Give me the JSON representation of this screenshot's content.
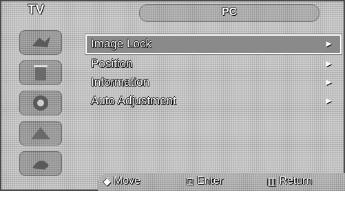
{
  "header": {
    "title": "TV",
    "menu_title": "PC"
  },
  "sidebar": {
    "icons": [
      "picture-icon",
      "sound-icon",
      "channel-icon",
      "setup-icon",
      "input-icon"
    ]
  },
  "menu": {
    "items": [
      {
        "label": "Image Lock",
        "arrow": "►",
        "selected": true
      },
      {
        "label": "Position",
        "arrow": "►"
      },
      {
        "label": "Information",
        "arrow": "►"
      },
      {
        "label": "Auto Adjustment",
        "arrow": "►"
      }
    ]
  },
  "footer": {
    "move": {
      "icon": "◆",
      "label": "Move"
    },
    "enter": {
      "icon": "⊡",
      "label": "Enter"
    },
    "return": {
      "icon": "▥",
      "label": "Return"
    }
  }
}
